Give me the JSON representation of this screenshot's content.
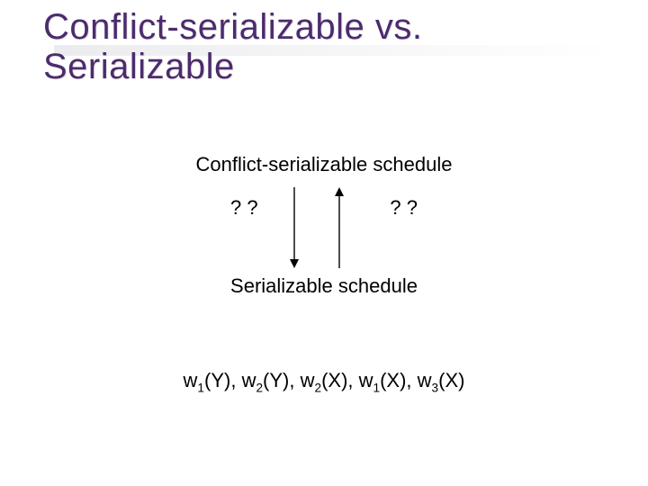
{
  "title": "Conflict-serializable vs. Serializable",
  "label_top": "Conflict-serializable schedule",
  "label_mid": "Serializable schedule",
  "qq_left": "? ?",
  "qq_right": "? ?",
  "ops": [
    {
      "op": "w",
      "sub": "1",
      "arg": "(Y)"
    },
    {
      "op": "w",
      "sub": "2",
      "arg": "(Y)"
    },
    {
      "op": "w",
      "sub": "2",
      "arg": "(X)"
    },
    {
      "op": "w",
      "sub": "1",
      "arg": "(X)"
    },
    {
      "op": "w",
      "sub": "3",
      "arg": "(X)"
    }
  ]
}
